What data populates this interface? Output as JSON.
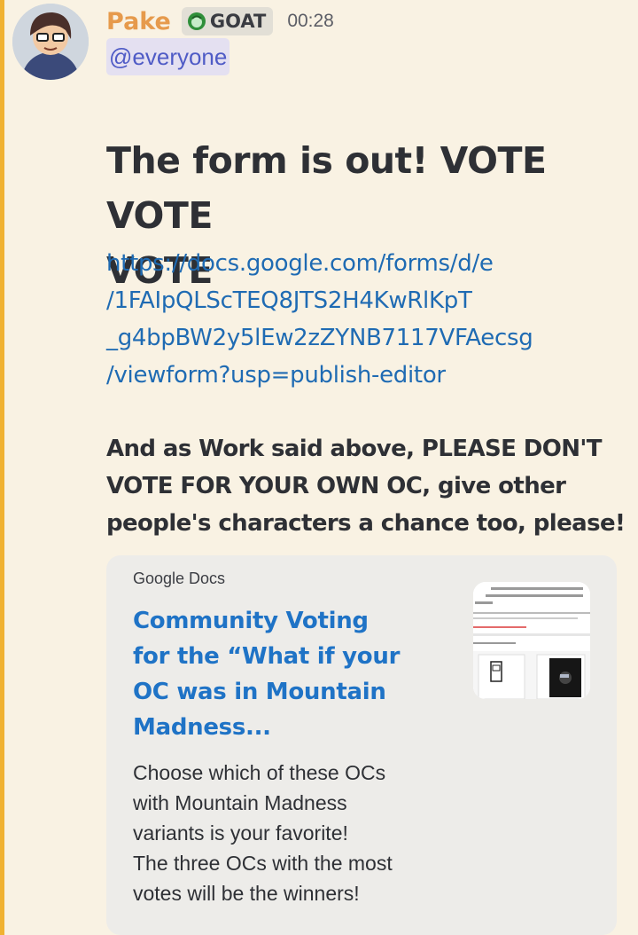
{
  "message": {
    "author": "Pake",
    "role_tag": "GOAT",
    "timestamp": "00:28",
    "mention": "@everyone",
    "heading_lines": [
      "The form is out! VOTE VOTE",
      "VOTE"
    ],
    "link_lines": [
      "https://docs.google.com/forms/d/e",
      "/1FAIpQLScTEQ8JTS2H4KwRlKpT",
      "_g4bpBW2y5lEw2zZYNB7117VFAecsg",
      "/viewform?usp=publish-editor"
    ],
    "body_lines": [
      "And as Work said above, PLEASE DON'T",
      "VOTE FOR YOUR OWN OC, give other",
      "people's characters a chance too, please!"
    ]
  },
  "embed": {
    "provider": "Google Docs",
    "title_lines": [
      "Community Voting",
      "for the “What if your",
      "OC was in Mountain",
      "Madness..."
    ],
    "description_lines": [
      "Choose which of these OCs",
      "with Mountain Madness",
      "variants is your favorite!",
      "The three OCs with the most",
      "votes will be the winners!"
    ]
  },
  "colors": {
    "background": "#f9f2e3",
    "mention_highlight_bar": "#f0b232",
    "username": "#e69a4c",
    "link": "#1f6bb3",
    "embed_title": "#1f73c6"
  },
  "icons": {
    "role": "green-circle-role-icon",
    "avatar": "user-avatar"
  }
}
